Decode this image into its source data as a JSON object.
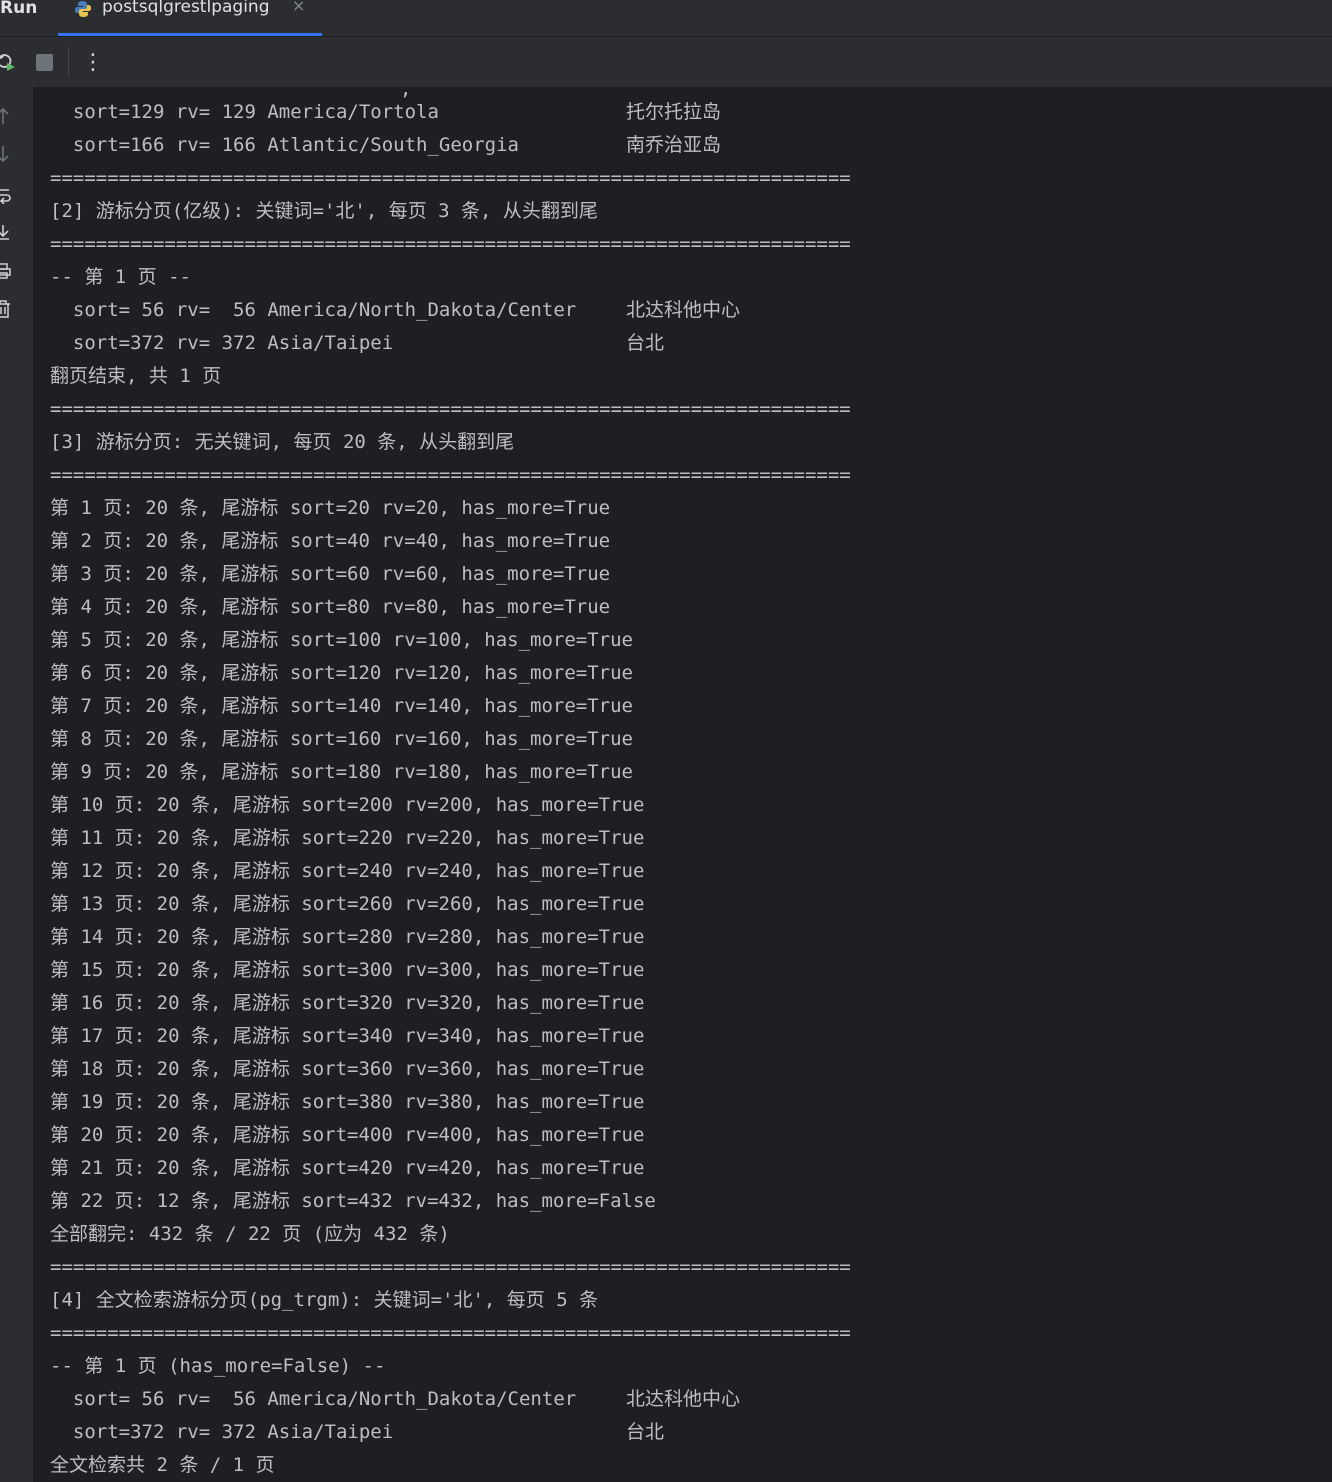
{
  "tool_window": {
    "title": "Run"
  },
  "tab": {
    "label": "postsqlgrestlpaging",
    "icon": "python-icon",
    "close": "×"
  },
  "toolbar": {
    "buttons": [
      "rerun-icon",
      "stop-icon",
      "more-options-icon"
    ],
    "more_label": "⋮"
  },
  "sidebar": {
    "buttons": [
      "scroll-up-icon",
      "scroll-down-icon",
      "soft-wrap-icon",
      "scroll-to-end-icon",
      "print-icon",
      "clear-all-icon"
    ]
  },
  "colors": {
    "background": "#1e1f22",
    "panel": "#2b2d30",
    "text": "#bcbec4",
    "accent": "#3574f0"
  },
  "console": {
    "partial_top": ",",
    "lines": [
      {
        "text": "  sort=129 rv= 129 America/Tortola",
        "cjk": "托尔托拉岛"
      },
      {
        "text": "  sort=166 rv= 166 Atlantic/South_Georgia",
        "cjk": "南乔治亚岛"
      },
      {
        "text": "======================================================================"
      },
      {
        "text": "[2] 游标分页(亿级): 关键词='北', 每页 3 条, 从头翻到尾"
      },
      {
        "text": "======================================================================"
      },
      {
        "text": "-- 第 1 页 --"
      },
      {
        "text": "  sort= 56 rv=  56 America/North_Dakota/Center",
        "cjk": "北达科他中心"
      },
      {
        "text": "  sort=372 rv= 372 Asia/Taipei",
        "cjk": "台北"
      },
      {
        "text": "翻页结束, 共 1 页"
      },
      {
        "text": "======================================================================"
      },
      {
        "text": "[3] 游标分页: 无关键词, 每页 20 条, 从头翻到尾"
      },
      {
        "text": "======================================================================"
      },
      {
        "text": "第 1 页: 20 条, 尾游标 sort=20 rv=20, has_more=True"
      },
      {
        "text": "第 2 页: 20 条, 尾游标 sort=40 rv=40, has_more=True"
      },
      {
        "text": "第 3 页: 20 条, 尾游标 sort=60 rv=60, has_more=True"
      },
      {
        "text": "第 4 页: 20 条, 尾游标 sort=80 rv=80, has_more=True"
      },
      {
        "text": "第 5 页: 20 条, 尾游标 sort=100 rv=100, has_more=True"
      },
      {
        "text": "第 6 页: 20 条, 尾游标 sort=120 rv=120, has_more=True"
      },
      {
        "text": "第 7 页: 20 条, 尾游标 sort=140 rv=140, has_more=True"
      },
      {
        "text": "第 8 页: 20 条, 尾游标 sort=160 rv=160, has_more=True"
      },
      {
        "text": "第 9 页: 20 条, 尾游标 sort=180 rv=180, has_more=True"
      },
      {
        "text": "第 10 页: 20 条, 尾游标 sort=200 rv=200, has_more=True"
      },
      {
        "text": "第 11 页: 20 条, 尾游标 sort=220 rv=220, has_more=True"
      },
      {
        "text": "第 12 页: 20 条, 尾游标 sort=240 rv=240, has_more=True"
      },
      {
        "text": "第 13 页: 20 条, 尾游标 sort=260 rv=260, has_more=True"
      },
      {
        "text": "第 14 页: 20 条, 尾游标 sort=280 rv=280, has_more=True"
      },
      {
        "text": "第 15 页: 20 条, 尾游标 sort=300 rv=300, has_more=True"
      },
      {
        "text": "第 16 页: 20 条, 尾游标 sort=320 rv=320, has_more=True"
      },
      {
        "text": "第 17 页: 20 条, 尾游标 sort=340 rv=340, has_more=True"
      },
      {
        "text": "第 18 页: 20 条, 尾游标 sort=360 rv=360, has_more=True"
      },
      {
        "text": "第 19 页: 20 条, 尾游标 sort=380 rv=380, has_more=True"
      },
      {
        "text": "第 20 页: 20 条, 尾游标 sort=400 rv=400, has_more=True"
      },
      {
        "text": "第 21 页: 20 条, 尾游标 sort=420 rv=420, has_more=True"
      },
      {
        "text": "第 22 页: 12 条, 尾游标 sort=432 rv=432, has_more=False"
      },
      {
        "text": "全部翻完: 432 条 / 22 页 (应为 432 条)"
      },
      {
        "text": "======================================================================"
      },
      {
        "text": "[4] 全文检索游标分页(pg_trgm): 关键词='北', 每页 5 条"
      },
      {
        "text": "======================================================================"
      },
      {
        "text": "-- 第 1 页 (has_more=False) --"
      },
      {
        "text": "  sort= 56 rv=  56 America/North_Dakota/Center",
        "cjk": "北达科他中心"
      },
      {
        "text": "  sort=372 rv= 372 Asia/Taipei",
        "cjk": "台北"
      },
      {
        "text": "全文检索共 2 条 / 1 页"
      }
    ]
  }
}
